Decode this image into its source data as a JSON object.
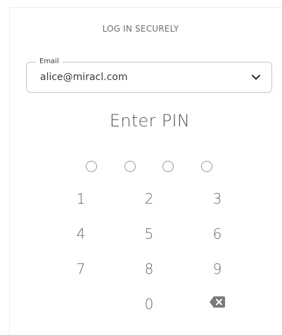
{
  "header": {
    "title": "LOG IN SECURELY"
  },
  "email_field": {
    "label": "Email",
    "value": "alice@miracl.com",
    "dropdown_icon": "chevron-down-icon"
  },
  "pin": {
    "title": "Enter PIN",
    "digits_entered": 0,
    "digits_total": 4
  },
  "keypad": {
    "k1": "1",
    "k2": "2",
    "k3": "3",
    "k4": "4",
    "k5": "5",
    "k6": "6",
    "k7": "7",
    "k8": "8",
    "k9": "9",
    "k0": "0",
    "backspace_icon": "backspace-icon"
  },
  "colors": {
    "text": "#5b5b5b",
    "border": "#c6c6c6",
    "icon": "#7a7a7a"
  }
}
